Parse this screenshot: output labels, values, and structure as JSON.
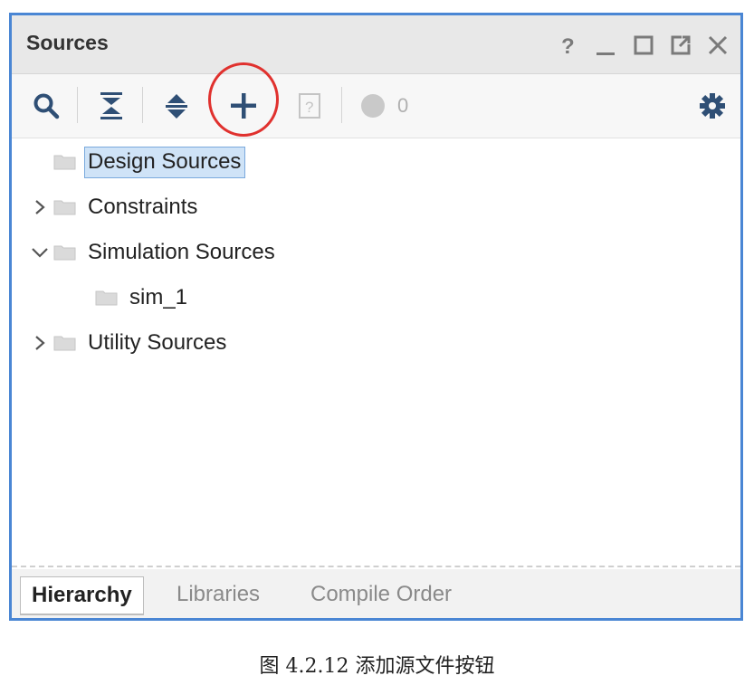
{
  "panel": {
    "title": "Sources",
    "window_controls": [
      "help-icon",
      "minimize-icon",
      "maximize-icon",
      "float-icon",
      "close-icon"
    ]
  },
  "toolbar": {
    "buttons": [
      "search-icon",
      "collapse-all-icon",
      "expand-all-icon",
      "add-sources-icon",
      "unknown-file-icon",
      "status-dot-icon",
      "settings-gear-icon"
    ],
    "status_count": "0",
    "highlight_color": "#e0312e"
  },
  "tree": {
    "items": [
      {
        "label": "Design Sources",
        "selected": true
      },
      {
        "label": "Constraints",
        "expander": "collapsed"
      },
      {
        "label": "Simulation Sources",
        "expander": "expanded"
      },
      {
        "label": "sim_1",
        "child": true
      },
      {
        "label": "Utility Sources",
        "expander": "collapsed"
      }
    ]
  },
  "tabs": [
    {
      "label": "Hierarchy",
      "active": true
    },
    {
      "label": "Libraries",
      "active": false
    },
    {
      "label": "Compile Order",
      "active": false
    }
  ],
  "caption": "图  4.2.12  添加源文件按钮",
  "colors": {
    "panel_border": "#4a86d4",
    "selection_bg": "#cfe3f7",
    "icon_blue": "#2f4f75"
  }
}
